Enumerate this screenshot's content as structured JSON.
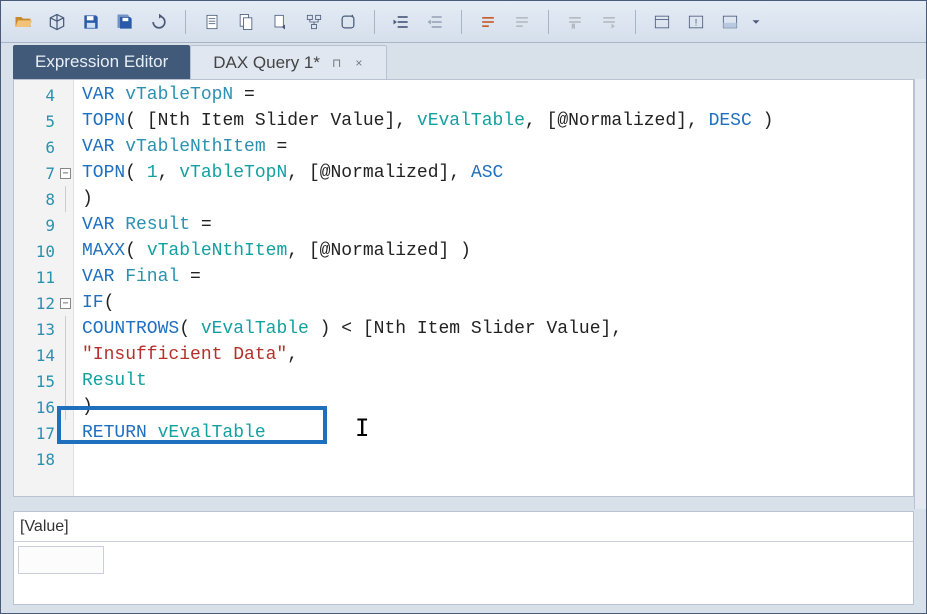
{
  "tabs": {
    "expression_editor": "Expression Editor",
    "dax_query": "DAX Query 1*",
    "pin_glyph": "⊓",
    "close_glyph": "×"
  },
  "gutter": [
    "4",
    "5",
    "6",
    "7",
    "8",
    "9",
    "10",
    "11",
    "12",
    "13",
    "14",
    "15",
    "16",
    "17",
    "18"
  ],
  "code": {
    "l4": {
      "kw": "VAR",
      "var": " vTableTopN ",
      "eq": "="
    },
    "l5": {
      "fn": "TOPN",
      "open": "( ",
      "col1": "[Nth Item Slider Value]",
      "c1": ", ",
      "ref1": "vEvalTable",
      "c2": ", ",
      "col2": "[@Normalized]",
      "c3": ", ",
      "desc": "DESC",
      "close": " )"
    },
    "l6": {
      "kw": "VAR",
      "var": " vTableNthItem ",
      "eq": "="
    },
    "l7": {
      "fn": "TOPN",
      "open": "( ",
      "num": "1",
      "c1": ", ",
      "ref1": "vTableTopN",
      "c2": ", ",
      "col1": "[@Normalized]",
      "c3": ", ",
      "asc": "ASC"
    },
    "l8": {
      "close": ")"
    },
    "l9": {
      "kw": "VAR",
      "var": " Result ",
      "eq": "="
    },
    "l10": {
      "fn": "MAXX",
      "open": "( ",
      "ref1": "vTableNthItem",
      "c1": ", ",
      "col1": "[@Normalized]",
      "close": " )"
    },
    "l11": {
      "kw": "VAR",
      "var": " Final ",
      "eq": "="
    },
    "l12": {
      "fn": "IF",
      "open": "("
    },
    "l13": {
      "fn": "COUNTROWS",
      "open": "( ",
      "ref1": "vEvalTable",
      "close": " ) ",
      "lt": "< ",
      "col1": "[Nth Item Slider Value]",
      "comma": ","
    },
    "l14": {
      "str": "\"Insufficient Data\"",
      "comma": ","
    },
    "l15": {
      "ref": "Result"
    },
    "l16": {
      "close": ")"
    },
    "l17": {
      "kw": "RETURN",
      "sp": " ",
      "ref": "vEvalTable"
    }
  },
  "results": {
    "header": "[Value]"
  },
  "chart_data": {
    "type": "table",
    "columns": [
      "[Value]"
    ],
    "rows": []
  },
  "icons": {
    "open": "open-icon",
    "cube": "cube-icon",
    "save": "save-icon",
    "saveall": "save-all-icon",
    "refresh": "refresh-icon",
    "page": "page-icon",
    "pagecopy": "page-copy-icon",
    "pagemove": "page-move-icon",
    "tree": "tree-icon",
    "loop": "loop-icon",
    "indent": "indent-icon",
    "outdent": "outdent-icon",
    "comment": "comment-icon",
    "uncomment": "uncomment-icon",
    "bookmark": "bookmark-icon",
    "bookmarknext": "bookmark-next-icon",
    "window": "window-icon",
    "info": "info-icon",
    "panel": "panel-icon",
    "drop": "dropdown-icon"
  }
}
